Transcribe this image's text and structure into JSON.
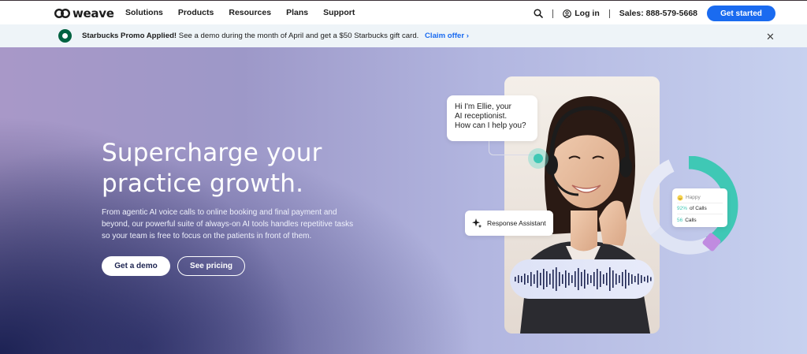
{
  "nav": {
    "logo_text": "weave",
    "menu": [
      {
        "label": "Solutions"
      },
      {
        "label": "Products"
      },
      {
        "label": "Resources"
      },
      {
        "label": "Plans"
      },
      {
        "label": "Support"
      }
    ],
    "login_label": "Log in",
    "sales_label": "Sales: 888-579-5668",
    "cta_label": "Get started",
    "accent_color": "#1a6bf0"
  },
  "promo": {
    "title": "Starbucks Promo Applied!",
    "message": "See a demo during the month of April and get a $50 Starbucks gift card.",
    "claim_label": "Claim offer",
    "claim_chevron": "›",
    "close_glyph": "✕"
  },
  "hero": {
    "title": "Supercharge your practice growth.",
    "description": "From agentic AI voice calls to online booking and final payment and beyond, our powerful suite of always-on AI tools handles repetitive tasks so your team is free to focus on the patients in front of them.",
    "primary_button": "Get a demo",
    "secondary_button": "See pricing"
  },
  "chat_bubble": {
    "lines": [
      "Hi I'm Ellie, your",
      "AI receptionist.",
      "How can I help you?"
    ]
  },
  "assistant_card": {
    "label": "Response Assistant"
  },
  "stats_card": {
    "mood": "Happy",
    "calls_percent": "92%",
    "calls_percent_suffix": "of Calls",
    "calls_count": "56",
    "calls_count_suffix": "Calls",
    "colors": {
      "teal": "#3fc8b5",
      "purple": "#c08be0"
    }
  }
}
